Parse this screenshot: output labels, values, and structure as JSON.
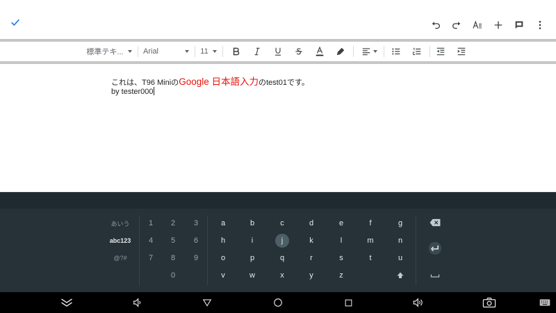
{
  "toolbar": {
    "style_label": "標準テキ...",
    "font_label": "Arial",
    "size_label": "11"
  },
  "document": {
    "line1_pre": "これは、T96 Miniの",
    "line1_red": "Google 日本語入力",
    "line1_post": "のtest01です。",
    "line2": "by tester000"
  },
  "keyboard": {
    "modes": [
      "あいう",
      "abc123",
      "@?#"
    ],
    "num_row1": [
      "1",
      "2",
      "3"
    ],
    "num_row2": [
      "4",
      "5",
      "6"
    ],
    "num_row3": [
      "7",
      "8",
      "9"
    ],
    "num_zero": "0",
    "row1": [
      "a",
      "b",
      "c",
      "d",
      "e",
      "f",
      "g"
    ],
    "row2": [
      "h",
      "i",
      "j",
      "k",
      "l",
      "m",
      "n"
    ],
    "row3": [
      "o",
      "p",
      "q",
      "r",
      "s",
      "t",
      "u"
    ],
    "row4": [
      "v",
      "w",
      "x",
      "y",
      "z"
    ]
  },
  "colors": {
    "accent_check": "#1a73e8",
    "red_text": "#e8120c",
    "keyboard_bg": "#263238"
  }
}
